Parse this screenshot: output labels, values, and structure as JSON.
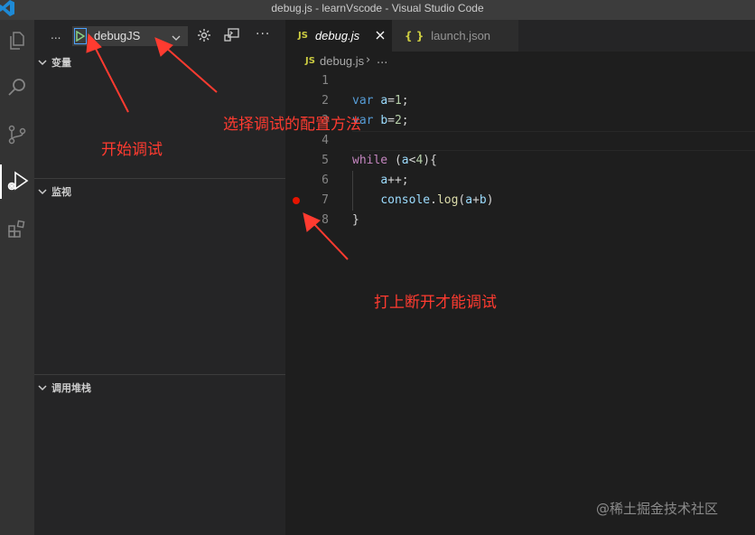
{
  "window": {
    "title": "debug.js - learnVscode - Visual Studio Code"
  },
  "debug_toolbar": {
    "more_left": "...",
    "launch_config": "debugJS",
    "more_right": "···"
  },
  "sidebar": {
    "sections": [
      {
        "label": "变量"
      },
      {
        "label": "监视"
      },
      {
        "label": "调用堆栈"
      }
    ]
  },
  "tabs": [
    {
      "badge": "JS",
      "label": "debug.js",
      "active": true
    },
    {
      "badge": "{ }",
      "label": "launch.json",
      "active": false
    }
  ],
  "breadcrumb": {
    "badge": "JS",
    "file": "debug.js",
    "separator": "›",
    "more": "..."
  },
  "editor": {
    "line_numbers": [
      "1",
      "2",
      "3",
      "4",
      "5",
      "6",
      "7",
      "8"
    ],
    "breakpoint_line": 7,
    "current_line": 4
  },
  "annotations": {
    "start_debug": "开始调试",
    "choose_config": "选择调试的配置方法",
    "set_breakpoint": "打上断开才能调试"
  },
  "watermark": "@稀土掘金技术社区",
  "colors": {
    "accent": "#007acc",
    "annotation": "#ff3b30",
    "breakpoint": "#e51400"
  },
  "icons": [
    "vscode-logo-icon",
    "explorer-icon",
    "search-icon",
    "source-control-icon",
    "run-debug-icon",
    "extensions-icon",
    "play-icon",
    "chevron-down-icon",
    "gear-icon",
    "debug-console-icon",
    "close-icon"
  ]
}
